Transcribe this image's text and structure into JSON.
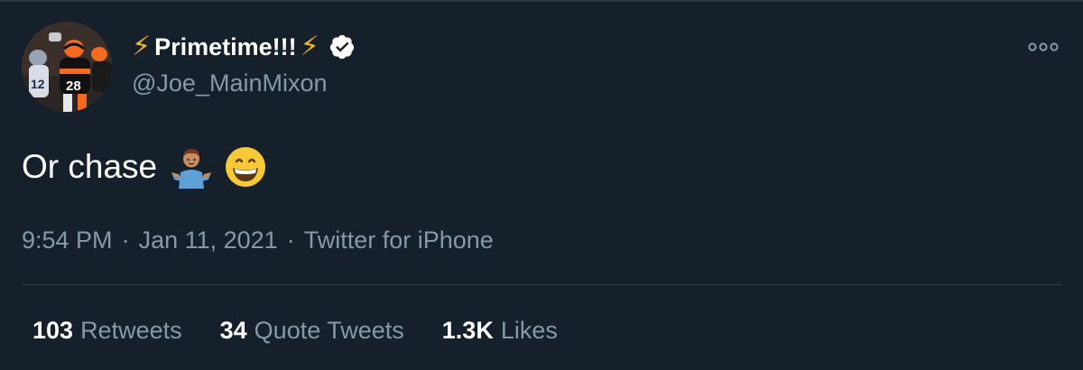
{
  "user": {
    "display_name": "Primetime!!!",
    "name_prefix_emoji": "⚡",
    "name_suffix_emoji": "⚡",
    "handle": "@Joe_MainMixon",
    "verified": true,
    "avatar_icon": "football-player-avatar"
  },
  "more_icon": "more-options-icon",
  "tweet": {
    "text": "Or chase",
    "emojis": [
      "person-shrugging",
      "grinning-face-with-smiling-eyes"
    ]
  },
  "meta": {
    "time": "9:54 PM",
    "sep1": "·",
    "date": "Jan 11, 2021",
    "sep2": "·",
    "source": "Twitter for iPhone"
  },
  "stats": {
    "retweets": {
      "count": "103",
      "label": "Retweets"
    },
    "quotes": {
      "count": "34",
      "label": "Quote Tweets"
    },
    "likes": {
      "count": "1.3K",
      "label": "Likes"
    }
  },
  "colors": {
    "background": "#15202b",
    "primary_text": "#ffffff",
    "secondary_text": "#8899a6",
    "divider": "#38444d",
    "bolt": "#f5b51c"
  }
}
